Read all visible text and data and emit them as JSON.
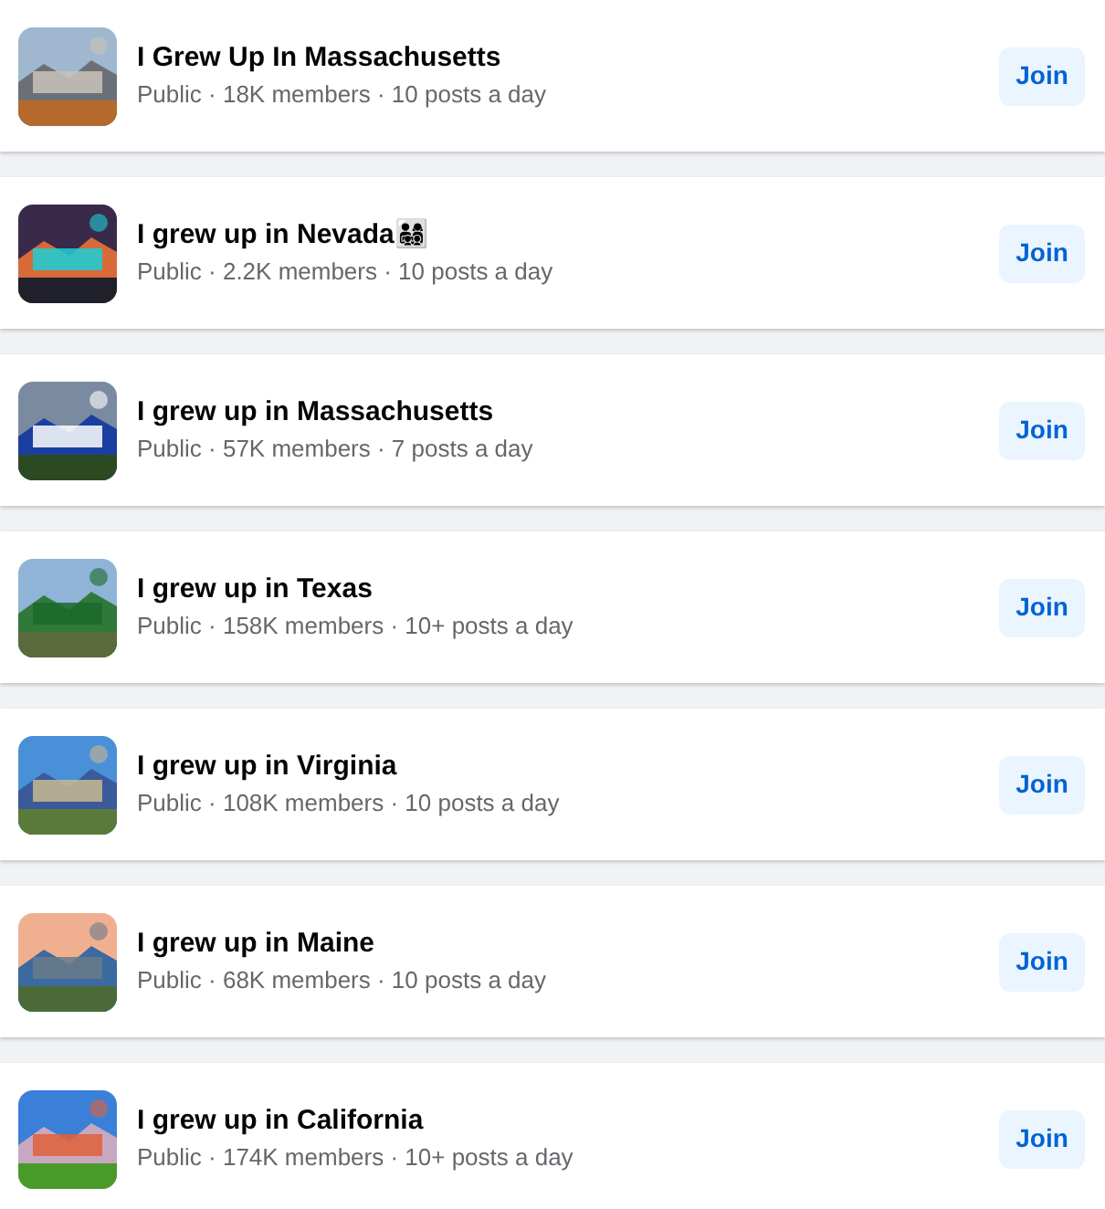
{
  "groups": [
    {
      "name": "I Grew Up In Massachusetts",
      "meta": "Public · 18K members · 10 posts a day",
      "button": "Join"
    },
    {
      "name": "I grew up in Nevada👨‍👩‍👧‍👦",
      "meta": "Public · 2.2K members · 10 posts a day",
      "button": "Join"
    },
    {
      "name": "I grew up in Massachusetts",
      "meta": "Public · 57K members · 7 posts a day",
      "button": "Join"
    },
    {
      "name": "I grew up in Texas",
      "meta": "Public · 158K members · 10+ posts a day",
      "button": "Join"
    },
    {
      "name": "I grew up in Virginia",
      "meta": "Public · 108K members · 10 posts a day",
      "button": "Join"
    },
    {
      "name": "I grew up in Maine",
      "meta": "Public · 68K members · 10 posts a day",
      "button": "Join"
    },
    {
      "name": "I grew up in California",
      "meta": "Public · 174K members · 10+ posts a day",
      "button": "Join"
    }
  ]
}
